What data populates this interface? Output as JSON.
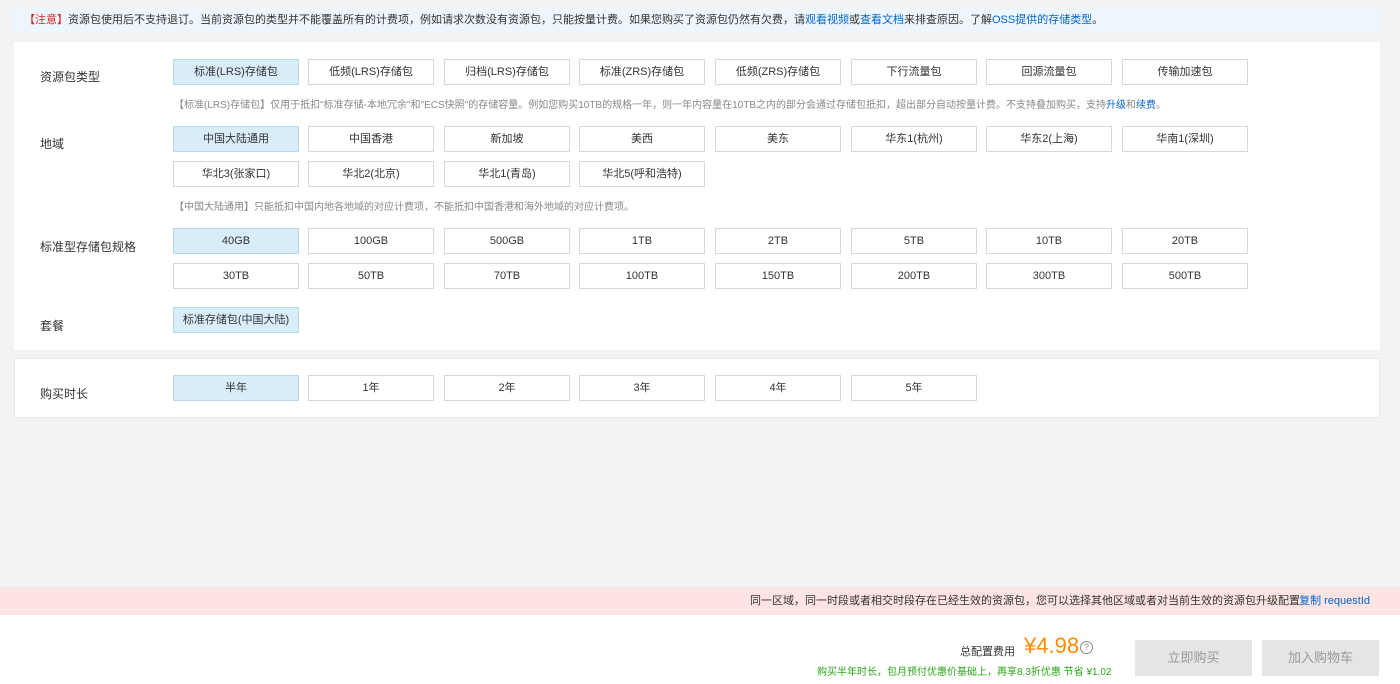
{
  "notice": {
    "warn": "【注意】",
    "text1": "资源包使用后不支持退订。当前资源包的类型并不能覆盖所有的计费项，例如请求次数没有资源包，只能按量计费。如果您购买了资源包仍然有欠费，请",
    "link1": "观看视频",
    "or": "或",
    "link2": "查看文档",
    "text2": "来排查原因。了解",
    "link3": "OSS提供的存储类型",
    "end": "。"
  },
  "package_type": {
    "label": "资源包类型",
    "options": [
      "标准(LRS)存储包",
      "低频(LRS)存储包",
      "归档(LRS)存储包",
      "标准(ZRS)存储包",
      "低频(ZRS)存储包",
      "下行流量包",
      "回源流量包",
      "传输加速包"
    ],
    "hint_pre": "【标准(LRS)存储包】仅用于抵扣\"标准存储-本地冗余\"和\"ECS快照\"的存储容量。例如您购买10TB的规格一年，则一年内容量在10TB之内的部分会通过存储包抵扣，超出部分自动按量计费。不支持叠加购买，支持",
    "hint_link1": "升级",
    "hint_and": "和",
    "hint_link2": "续费",
    "hint_end": "。"
  },
  "region": {
    "label": "地域",
    "options": [
      "中国大陆通用",
      "中国香港",
      "新加坡",
      "美西",
      "美东",
      "华东1(杭州)",
      "华东2(上海)",
      "华南1(深圳)",
      "华北3(张家口)",
      "华北2(北京)",
      "华北1(青岛)",
      "华北5(呼和浩特)"
    ],
    "hint": "【中国大陆通用】只能抵扣中国内地各地域的对应计费项，不能抵扣中国香港和海外地域的对应计费项。"
  },
  "spec": {
    "label": "标准型存储包规格",
    "options": [
      "40GB",
      "100GB",
      "500GB",
      "1TB",
      "2TB",
      "5TB",
      "10TB",
      "20TB",
      "30TB",
      "50TB",
      "70TB",
      "100TB",
      "150TB",
      "200TB",
      "300TB",
      "500TB"
    ]
  },
  "plan": {
    "label": "套餐",
    "option": "标准存储包(中国大陆)"
  },
  "duration": {
    "label": "购买时长",
    "options": [
      "半年",
      "1年",
      "2年",
      "3年",
      "4年",
      "5年"
    ]
  },
  "tipbar": {
    "message": "同一区域，同一时段或者相交时段存在已经生效的资源包，您可以选择其他区域或者对当前生效的资源包升级配置",
    "copy": "复制 requestId"
  },
  "footer": {
    "total_label": "总配置费用",
    "price": "¥4.98",
    "help": "?",
    "promo": "购买半年时长，包月预付优惠价基础上，再享8.3折优惠  节省 ¥1.02",
    "buy_now": "立即购买",
    "add_cart": "加入购物车"
  },
  "colors": {
    "selected_bg": "#d9ecfa",
    "price": "#ff8a00",
    "link": "#0066cc",
    "warn": "#e02020",
    "tip_bg": "#fde3e1"
  }
}
